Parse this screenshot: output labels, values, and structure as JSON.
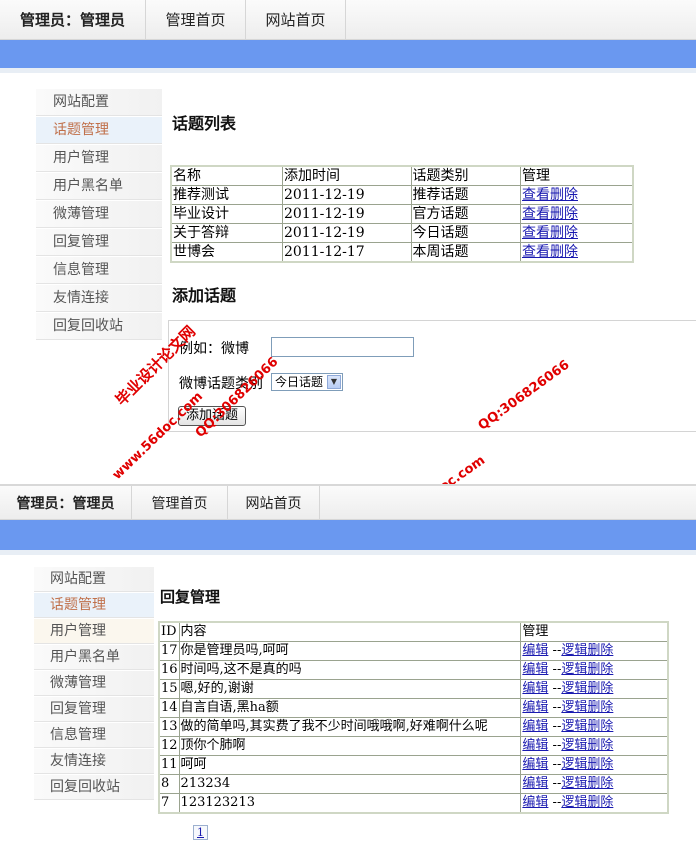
{
  "header": {
    "admin_label": "管理员：管理员",
    "nav": [
      "管理首页",
      "网站首页"
    ]
  },
  "sidebar": {
    "items": [
      "网站配置",
      "话题管理",
      "用户管理",
      "用户黑名单",
      "微薄管理",
      "回复管理",
      "信息管理",
      "友情连接",
      "回复回收站"
    ],
    "active_index": 1
  },
  "topic_list": {
    "title": "话题列表",
    "columns": [
      "名称",
      "添加时间",
      "话题类别",
      "管理"
    ],
    "rows": [
      {
        "name": "推荐测试",
        "date": "2011-12-19",
        "category": "推荐话题",
        "action": "查看删除"
      },
      {
        "name": "毕业设计",
        "date": "2011-12-19",
        "category": "官方话题",
        "action": "查看删除"
      },
      {
        "name": "关于答辩",
        "date": "2011-12-19",
        "category": "今日话题",
        "action": "查看删除"
      },
      {
        "name": "世博会",
        "date": "2011-12-17",
        "category": "本周话题",
        "action": "查看删除"
      }
    ]
  },
  "add_topic": {
    "title": "添加话题",
    "name_label": "例如：微博",
    "name_value": "",
    "category_label": "微博话题类别",
    "category_selected": "今日话题",
    "submit_label": "添加话题"
  },
  "reply_manage": {
    "title": "回复管理",
    "columns": [
      "ID",
      "内容",
      "管理"
    ],
    "edit_label": "编辑",
    "separator": "--",
    "delete_label": "逻辑删除",
    "rows": [
      {
        "id": "17",
        "content": "你是管理员吗,呵呵"
      },
      {
        "id": "16",
        "content": "时间吗,这不是真的吗"
      },
      {
        "id": "15",
        "content": "嗯,好的,谢谢"
      },
      {
        "id": "14",
        "content": "自言自语,黑ha额"
      },
      {
        "id": "13",
        "content": "做的简单吗,其实费了我不少时间哦哦啊,好难啊什么呢"
      },
      {
        "id": "12",
        "content": "顶你个肺啊"
      },
      {
        "id": "11",
        "content": "呵呵"
      },
      {
        "id": "8",
        "content": "213234"
      },
      {
        "id": "7",
        "content": "123123213"
      }
    ],
    "pager": "1"
  },
  "watermarks": {
    "site": "www.56doc.com",
    "qq": "QQ:306826066",
    "name": "毕业设计论文网"
  },
  "colors": {
    "blue_band": "#6a98f0",
    "active_text": "#c0704a",
    "link": "#1a1ab0",
    "watermark": "#e00000"
  }
}
